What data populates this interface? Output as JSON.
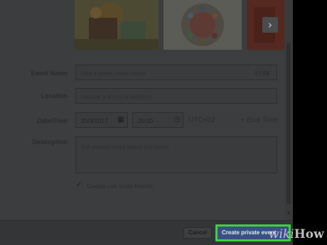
{
  "form": {
    "event_name": {
      "label": "Event Name",
      "placeholder": "Add a short, clear name",
      "counter": "0 / 64"
    },
    "location": {
      "label": "Location",
      "placeholder": "Include a place or address"
    },
    "datetime": {
      "label": "Date/Time",
      "date": "20/3/2017",
      "time": "20:00",
      "timezone": "UTC+02",
      "end_time": "+ End Time"
    },
    "description": {
      "label": "Description",
      "placeholder": "Tell people more about the event"
    },
    "guests": {
      "label": "Guests can invite friends",
      "checked": true
    }
  },
  "footer": {
    "cancel": "Cancel",
    "create": "Create private event"
  },
  "watermark": {
    "part1": "wiki",
    "part2": "How"
  },
  "icons": {
    "next": "chevron-right-icon",
    "calendar": "calendar-icon",
    "clock": "clock-icon",
    "check": "checkmark-icon",
    "scroll": "scroll-down-arrow-icon"
  },
  "colors": {
    "highlight": "#3ad43a",
    "primary_button": "#3b4f86"
  }
}
